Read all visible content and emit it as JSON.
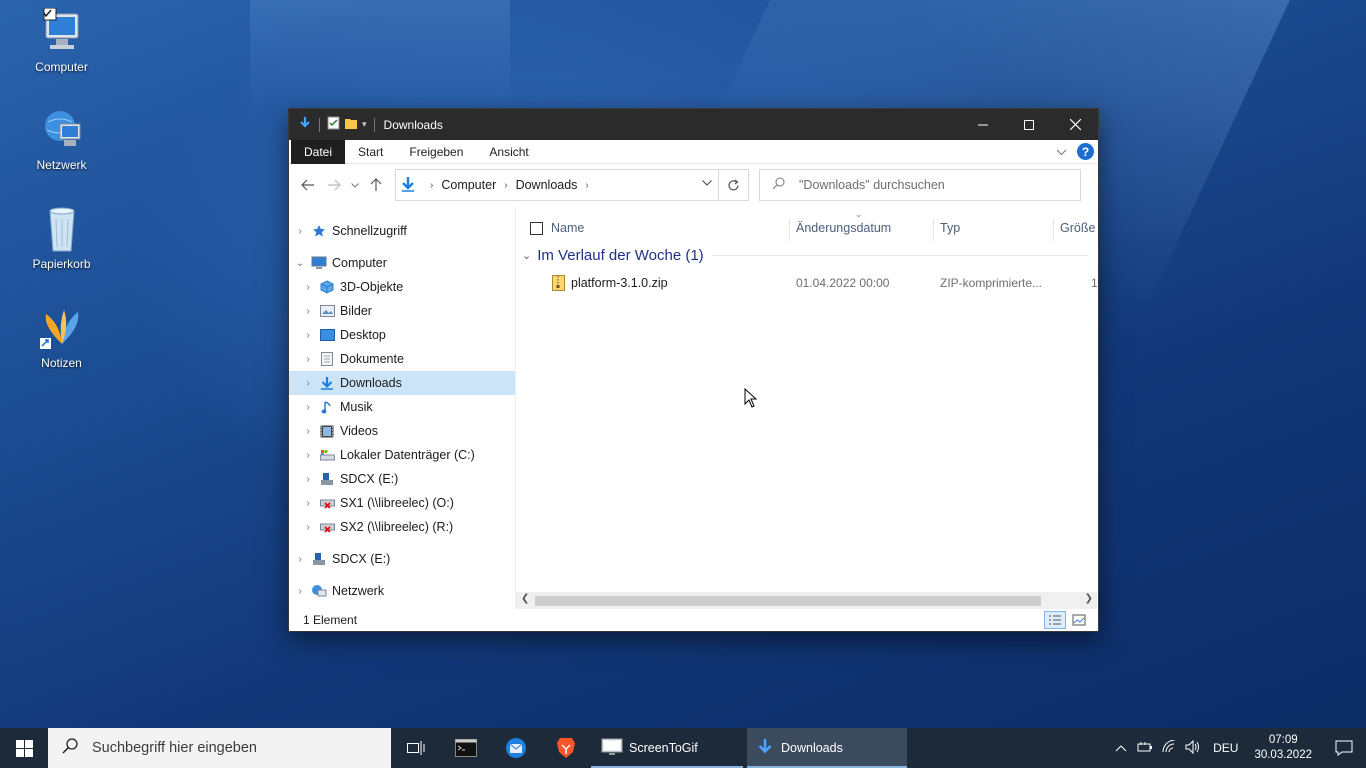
{
  "desktop": {
    "icons": [
      {
        "label": "Computer"
      },
      {
        "label": "Netzwerk"
      },
      {
        "label": "Papierkorb"
      },
      {
        "label": "Notizen"
      }
    ]
  },
  "window": {
    "title": "Downloads",
    "ribbon_tabs": [
      "Datei",
      "Start",
      "Freigeben",
      "Ansicht"
    ],
    "help_label": "?",
    "address": {
      "crumbs": [
        "Computer",
        "Downloads"
      ]
    },
    "search": {
      "placeholder": "\"Downloads\" durchsuchen"
    },
    "nav": [
      {
        "label": "Schnellzugriff",
        "icon": "star-icon"
      },
      {
        "label": "Computer",
        "icon": "computer-icon"
      },
      {
        "label": "3D-Objekte",
        "icon": "cube-icon"
      },
      {
        "label": "Bilder",
        "icon": "pictures-icon"
      },
      {
        "label": "Desktop",
        "icon": "desktop-icon"
      },
      {
        "label": "Dokumente",
        "icon": "documents-icon"
      },
      {
        "label": "Downloads",
        "icon": "download-icon"
      },
      {
        "label": "Musik",
        "icon": "music-icon"
      },
      {
        "label": "Videos",
        "icon": "videos-icon"
      },
      {
        "label": "Lokaler Datenträger (C:)",
        "icon": "drive-icon"
      },
      {
        "label": "SDCX (E:)",
        "icon": "usb-drive-icon"
      },
      {
        "label": "SX1 (\\\\libreelec) (O:)",
        "icon": "network-drive-icon"
      },
      {
        "label": "SX2 (\\\\libreelec) (R:)",
        "icon": "network-drive-icon"
      },
      {
        "label": "SDCX (E:)",
        "icon": "usb-drive-icon"
      },
      {
        "label": "Netzwerk",
        "icon": "network-icon"
      }
    ],
    "columns": {
      "name": "Name",
      "date": "Änderungsdatum",
      "type": "Typ",
      "size": "Größe"
    },
    "group_label": "Im Verlauf der Woche (1)",
    "files": [
      {
        "name": "platform-3.1.0.zip",
        "date": "01.04.2022 00:00",
        "type": "ZIP-komprimierte...",
        "size": "1"
      }
    ],
    "status": "1 Element"
  },
  "taskbar": {
    "search_placeholder": "Suchbegriff hier eingeben",
    "apps": [
      {
        "label": "ScreenToGif"
      },
      {
        "label": "Downloads"
      }
    ],
    "language": "DEU",
    "time": "07:09",
    "date": "30.03.2022"
  },
  "colors": {
    "accent": "#1a6fd0",
    "selection": "#cce4f7",
    "group_header": "#1e3287",
    "titlebar": "#2b2b2b",
    "taskbar": "#1c2a3a"
  }
}
